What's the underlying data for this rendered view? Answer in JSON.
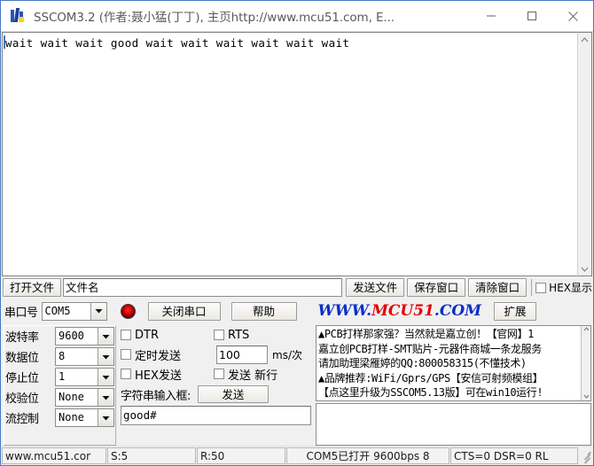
{
  "window": {
    "title": "SSCOM3.2 (作者:聂小猛(丁丁), 主页http://www.mcu51.com, E...",
    "icon": "sscom-app-icon",
    "minimize_label": "—",
    "maximize_label": "□",
    "close_label": "✕",
    "accent_color": "#4a77c4"
  },
  "receive": {
    "text": "wait wait wait good wait wait wait wait wait wait ",
    "scroll_up_icon": "chevron-up-icon",
    "scroll_down_icon": "chevron-down-icon"
  },
  "file_row": {
    "open_file_label": "打开文件",
    "file_name_value": "文件名",
    "send_file_label": "发送文件",
    "save_window_label": "保存窗口",
    "clear_window_label": "清除窗口",
    "hex_display_label": "HEX显示",
    "hex_display_checked": false
  },
  "com_row": {
    "port_label": "串口号",
    "port_value": "COM5",
    "led_name": "connection-led",
    "close_port_label": "关闭串口",
    "help_label": "帮助",
    "logo_part1": "WWW.",
    "logo_part2": "MCU51",
    "logo_part3": ".COM",
    "logo_blue": "#0a2ec7",
    "logo_red": "#e40000",
    "expand_label": "扩展"
  },
  "params": [
    {
      "label": "波特率",
      "value": "9600"
    },
    {
      "label": "数据位",
      "value": "8"
    },
    {
      "label": "停止位",
      "value": "1"
    },
    {
      "label": "校验位",
      "value": "None"
    },
    {
      "label": "流控制",
      "value": "None"
    }
  ],
  "options": {
    "dtr_label": "DTR",
    "dtr_checked": false,
    "rts_label": "RTS",
    "rts_checked": false,
    "timed_send_label": "定时发送",
    "timed_send_checked": false,
    "interval_value": "100",
    "interval_unit": "ms/次",
    "hex_send_label": "HEX发送",
    "hex_send_checked": false,
    "send_newline_label": "发送 新行",
    "send_newline_checked": false,
    "string_input_label": "字符串输入框:",
    "send_button_label": "发送",
    "send_input_value": "good#"
  },
  "ad_panel": {
    "lines": [
      "▲PCB打样那家强？当然就是嘉立创！【官网】1",
      "嘉立创PCB打样-SMT贴片-元器件商城一条龙服务",
      "请加助理梁雁婷的QQ:800058315(不懂技术)",
      "▲品牌推荐:WiFi/Gprs/GPS【安信可射频模组】",
      "【点这里升级为SSCOM5.13版】可在win10运行!"
    ],
    "scroll_up_icon": "chevron-up-icon",
    "scroll_down_icon": "chevron-down-icon"
  },
  "statusbar": {
    "url": "www.mcu51.cor",
    "sent": "S:5",
    "received": "R:50",
    "port_state": "COM5已打开  9600bps  8",
    "signals": "CTS=0 DSR=0 RL",
    "grip_name": "resize-grip"
  }
}
